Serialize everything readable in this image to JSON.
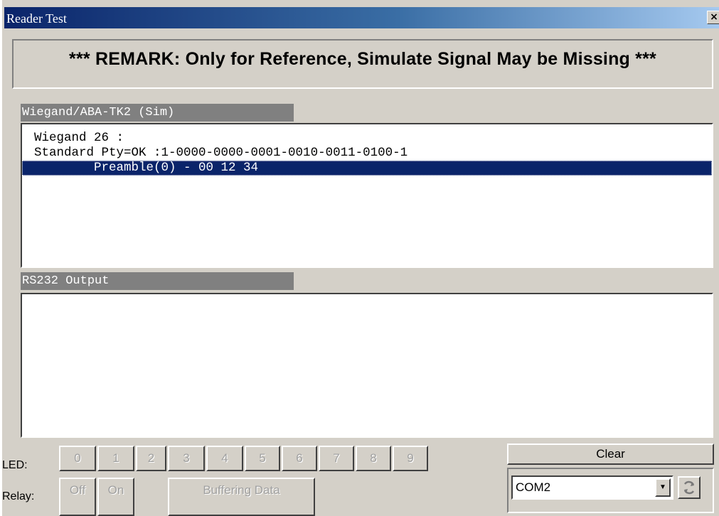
{
  "window": {
    "title": "Reader Test",
    "close_glyph": "×"
  },
  "remark": "*** REMARK: Only for Reference, Simulate Signal May be Missing ***",
  "wiegand": {
    "header": "Wiegand/ABA-TK2 (Sim)",
    "lines": [
      "Wiegand 26 :",
      "Standard Pty=OK :1-0000-0000-0001-0010-0011-0100-1",
      "        Preamble(0) - 00 12 34"
    ],
    "selected_index": 2
  },
  "rs232": {
    "header": "RS232 Output",
    "lines": []
  },
  "led": {
    "label": "LED:",
    "buttons": [
      "0",
      "1",
      "2",
      "3",
      "4",
      "5",
      "6",
      "7",
      "8",
      "9"
    ]
  },
  "relay": {
    "label": "Relay:",
    "off": "Off",
    "on": "On",
    "buffering": "Buffering Data"
  },
  "clear_label": "Clear",
  "com_port": {
    "selected": "COM2"
  },
  "colors": {
    "title_start": "#0a246a",
    "title_end": "#a6caf0",
    "selection": "#0a246a",
    "face": "#d4d0c8"
  },
  "icons": {
    "close": "close-icon",
    "dropdown": "chevron-down-icon",
    "refresh": "refresh-icon"
  }
}
